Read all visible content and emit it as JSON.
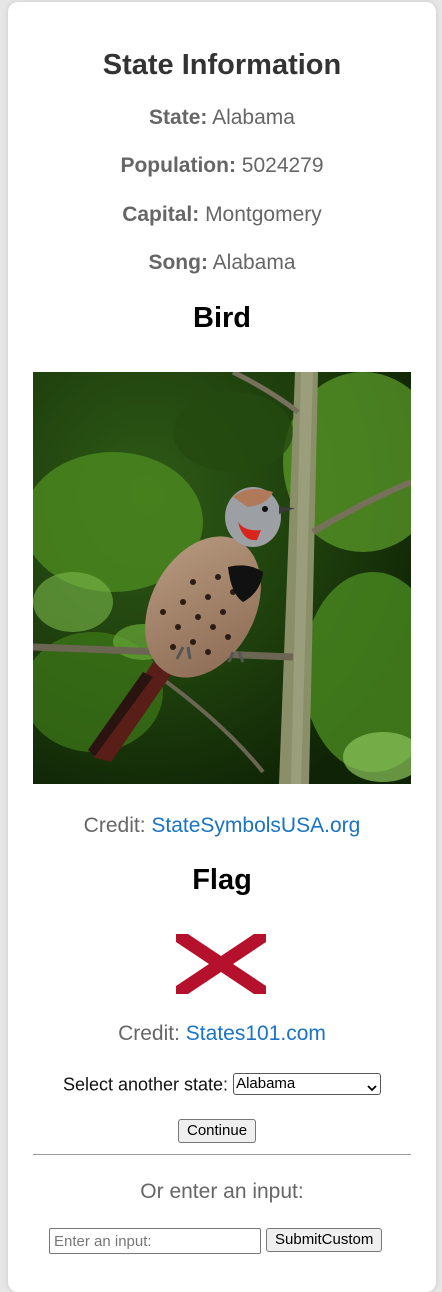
{
  "header": {
    "title": "State Information"
  },
  "info": {
    "state_label": "State:",
    "state_value": "Alabama",
    "population_label": "Population:",
    "population_value": "5024279",
    "capital_label": "Capital:",
    "capital_value": "Montgomery",
    "song_label": "Song:",
    "song_value": "Alabama"
  },
  "bird": {
    "heading": "Bird",
    "credit_label": "Credit:",
    "credit_link": "StateSymbolsUSA.org"
  },
  "flag": {
    "heading": "Flag",
    "credit_label": "Credit:",
    "credit_link": "States101.com",
    "cross_color": "#b5102c"
  },
  "selector": {
    "label": "Select another state:",
    "selected": "Alabama",
    "continue_label": "Continue"
  },
  "custom": {
    "prompt": "Or enter an input:",
    "placeholder": "Enter an input:",
    "submit_label": "SubmitCustom"
  }
}
